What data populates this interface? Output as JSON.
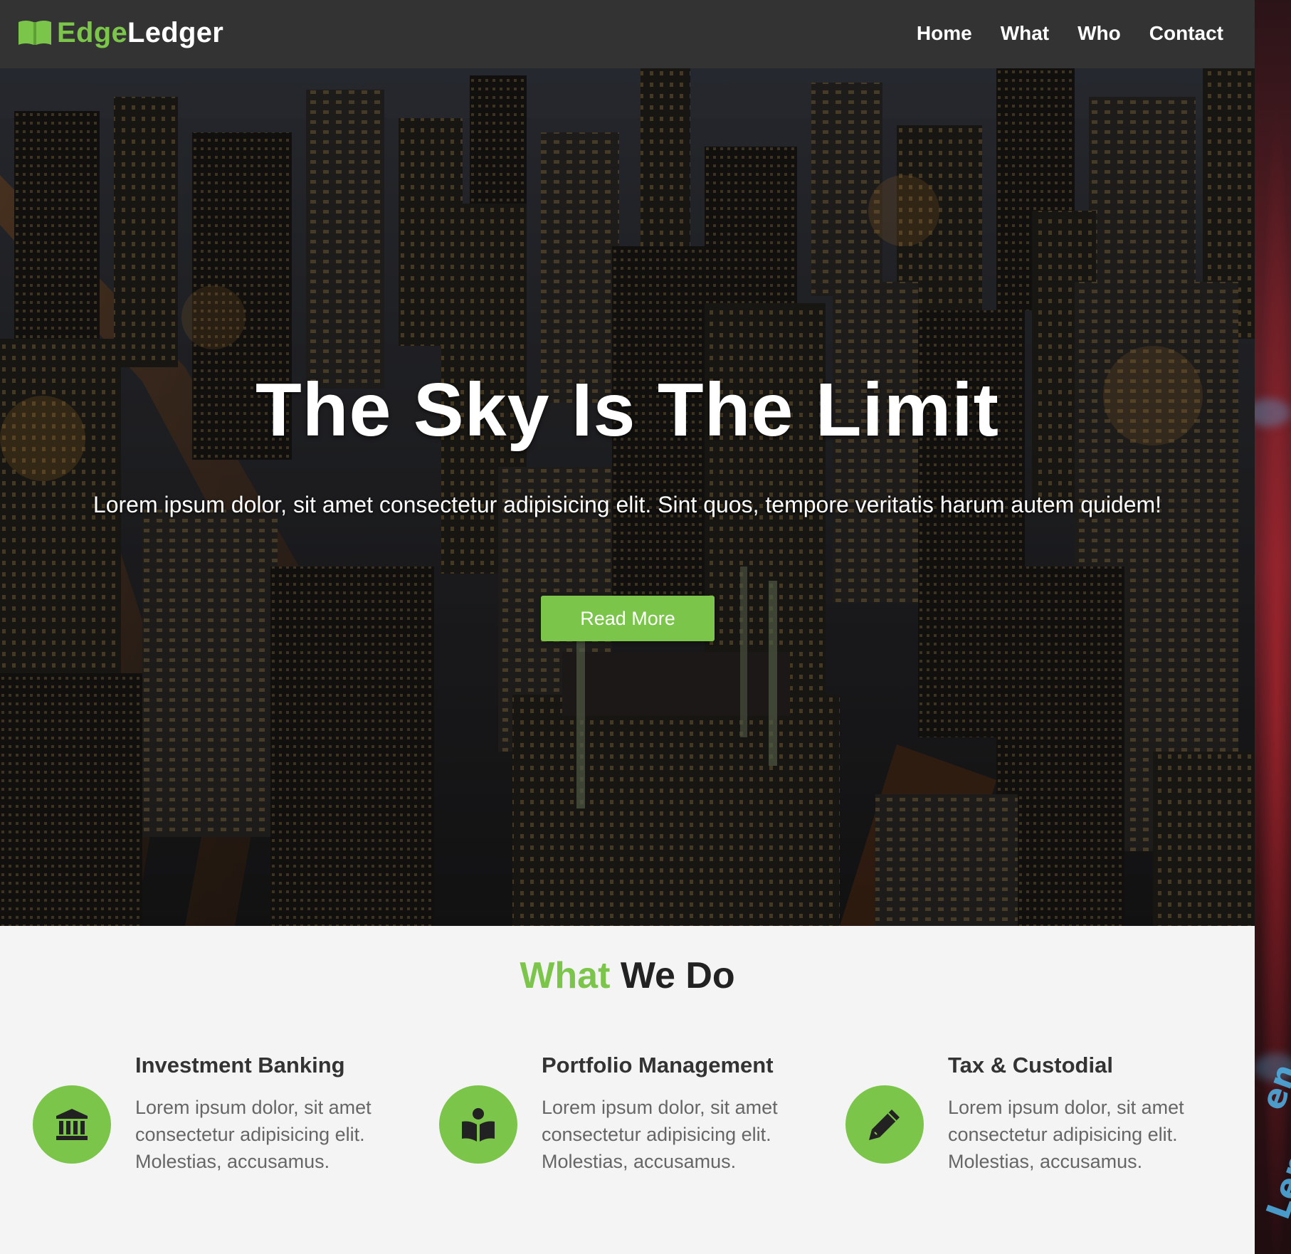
{
  "header": {
    "brand_accent": "Edge",
    "brand_main": "Ledger",
    "nav": [
      "Home",
      "What",
      "Who",
      "Contact"
    ]
  },
  "hero": {
    "title": "The Sky Is The Limit",
    "text": "Lorem ipsum dolor, sit amet consectetur adipisicing elit. Sint quos, tempore veritatis harum autem quidem!",
    "button_label": "Read More"
  },
  "section": {
    "title_accent": "What",
    "title_main": "We Do",
    "services": [
      {
        "icon": "bank-icon",
        "title": "Investment Banking",
        "desc": "Lorem ipsum dolor, sit amet consectetur adipisicing elit. Molestias, accusamus."
      },
      {
        "icon": "book-reader-icon",
        "title": "Portfolio Management",
        "desc": "Lorem ipsum dolor, sit amet consectetur adipisicing elit. Molestias, accusamus."
      },
      {
        "icon": "pencil-icon",
        "title": "Tax & Custodial",
        "desc": "Lorem ipsum dolor, sit amet consectetur adipisicing elit. Molestias, accusamus."
      }
    ]
  },
  "colors": {
    "accent": "#7cc54b",
    "header_bg": "#333333",
    "section_bg": "#f4f4f4"
  }
}
